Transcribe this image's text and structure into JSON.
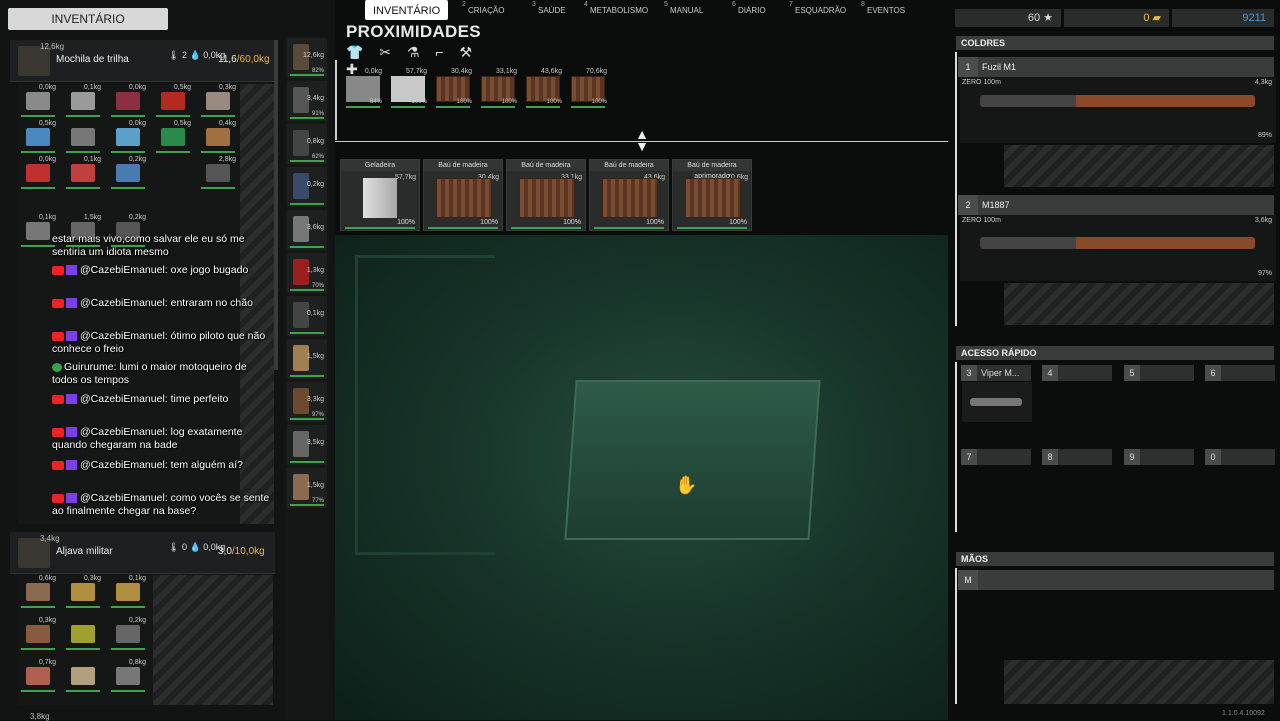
{
  "tabs": [
    {
      "num": "",
      "label": "INVENTÁRIO"
    },
    {
      "num": "2",
      "label": "CRIAÇÃO"
    },
    {
      "num": "3",
      "label": "SAÚDE"
    },
    {
      "num": "4",
      "label": "METABOLISMO"
    },
    {
      "num": "5",
      "label": "MANUAL"
    },
    {
      "num": "6",
      "label": "DIÁRIO"
    },
    {
      "num": "7",
      "label": "ESQUADRÃO"
    },
    {
      "num": "8",
      "label": "EVENTOS"
    }
  ],
  "left": {
    "title": "INVENTÁRIO",
    "pack1": {
      "weight": "12,6kg",
      "cond": "82%",
      "name": "Mochila de trilha",
      "temp_val": "2",
      "water_val": "0,0kg",
      "cap_used": "11,6",
      "cap_max": "/60,0kg"
    },
    "pack2": {
      "weight": "3,4kg",
      "cond": "91%",
      "name": "Aljava militar",
      "temp_val": "0",
      "water_val": "0,0kg",
      "cap_used": "3,0",
      "cap_max": "/10,0kg"
    },
    "pack3": {
      "weight": "3,8kg"
    },
    "grid1": [
      {
        "w": "0,0kg",
        "c": "#8a8a8a"
      },
      {
        "w": "0,1kg",
        "c": "#9a9a9a"
      },
      {
        "w": "0,0kg",
        "c": "#8a3040"
      },
      {
        "w": "0,5kg",
        "c": "#b32a20"
      },
      {
        "w": "0,3kg",
        "c": "#9a8a80"
      },
      {
        "w": "0,5kg",
        "c": "#4a88c0"
      },
      {
        "w": "",
        "c": "#777"
      },
      {
        "w": "0,0kg",
        "c": "#5aa0c8"
      },
      {
        "w": "0,5kg",
        "c": "#2a8a4a"
      },
      {
        "w": "0,4kg",
        "c": "#a07040"
      },
      {
        "w": "0,0kg",
        "c": "#c03030"
      },
      {
        "w": "0,1kg",
        "c": "#c04040"
      },
      {
        "w": "0,2kg",
        "c": "#4a7ab0"
      },
      {
        "w": "2,8kg",
        "c": "#555"
      },
      {
        "w": "0,1kg",
        "c": "#777"
      },
      {
        "w": "1,5kg",
        "c": "#666"
      },
      {
        "w": "0,2kg",
        "c": "#555"
      }
    ],
    "grid2": [
      {
        "w": "0,6kg",
        "c": "#8a6a50"
      },
      {
        "w": "0,3kg",
        "c": "#b09040"
      },
      {
        "w": "0,1kg",
        "c": "#b09040"
      },
      {
        "w": "0,3kg",
        "c": "#8a5a40"
      },
      {
        "w": "",
        "c": "#a0a030"
      },
      {
        "w": "0,2kg",
        "c": "#666"
      },
      {
        "w": "0,7kg",
        "c": "#b06050"
      },
      {
        "w": "",
        "c": "#b0a080"
      },
      {
        "w": "0,8kg",
        "c": "#777"
      }
    ],
    "col2": [
      {
        "w": "12,6kg",
        "p": "82%",
        "c": "#5a4a3a"
      },
      {
        "w": "3,4kg",
        "p": "91%",
        "c": "#555"
      },
      {
        "w": "0,8kg",
        "p": "62%",
        "c": "#444"
      },
      {
        "w": "0,2kg",
        "p": "",
        "c": "#3a4a6a"
      },
      {
        "w": "3,6kg",
        "p": "",
        "c": "#777"
      },
      {
        "w": "1,3kg",
        "p": "70%",
        "c": "#9a2020"
      },
      {
        "w": "0,1kg",
        "p": "",
        "c": "#444"
      },
      {
        "w": "1,5kg",
        "p": "",
        "c": "#a08050"
      },
      {
        "w": "3,3kg",
        "p": "97%",
        "c": "#6a4a30"
      },
      {
        "w": "3,5kg",
        "p": "",
        "c": "#666"
      },
      {
        "w": "1,5kg",
        "p": "77%",
        "c": "#8a6a50"
      }
    ],
    "chat": [
      {
        "u": "",
        "t": "estar mais vivo,como salvar ele eu só me sentiria um idiota mesmo",
        "src": ""
      },
      {
        "u": "@CazebiEmanuel:",
        "t": "oxe jogo bugado",
        "src": "yt"
      },
      {
        "u": "@CazebiEmanuel:",
        "t": "entraram no chão",
        "src": "yt"
      },
      {
        "u": "@CazebiEmanuel:",
        "t": "ótimo piloto que não conhece o freio",
        "src": "yt"
      },
      {
        "u": "Guirurume:",
        "t": "lumi o maior motoqueiro de todos os tempos",
        "src": "x"
      },
      {
        "u": "@CazebiEmanuel:",
        "t": "time perfeito",
        "src": "yt"
      },
      {
        "u": "@CazebiEmanuel:",
        "t": "log exatamente quando chegaram na bade",
        "src": "yt"
      },
      {
        "u": "@CazebiEmanuel:",
        "t": "tem alguém aí?",
        "src": "yt"
      },
      {
        "u": "@CazebiEmanuel:",
        "t": "como vocês se sente ao finalmente chegar na base?",
        "src": "yt"
      }
    ]
  },
  "proximity": {
    "title": "PROXIMIDADES",
    "icons": "👕 ✂ ⚗ ⌐ ⚒ ✚",
    "items": [
      {
        "w": "0,0kg",
        "p": "84%",
        "c": "#888"
      },
      {
        "w": "57,7kg",
        "p": "100%",
        "c": "#c8c8c8"
      },
      {
        "w": "30,4kg",
        "p": "100%",
        "c": "crate"
      },
      {
        "w": "33,1kg",
        "p": "100%",
        "c": "crate"
      },
      {
        "w": "43,6kg",
        "p": "100%",
        "c": "crate"
      },
      {
        "w": "70,6kg",
        "p": "100%",
        "c": "crate"
      }
    ],
    "boxes": [
      {
        "name": "Geladeira",
        "w": "57,7kg",
        "p": "100%",
        "t": "fridge"
      },
      {
        "name": "Baú de madeira",
        "w": "30,4kg",
        "p": "100%",
        "t": "crate"
      },
      {
        "name": "Baú de madeira",
        "w": "33,1kg",
        "p": "100%",
        "t": "crate"
      },
      {
        "name": "Baú de madeira",
        "w": "43,6kg",
        "p": "100%",
        "t": "crate"
      },
      {
        "name": "Baú de madeira aprimorado",
        "w": "70,6kg",
        "p": "100%",
        "t": "crate"
      }
    ]
  },
  "stats": {
    "stars": "60 ★",
    "gold": "0",
    "cash": "9211"
  },
  "right": {
    "holsters_title": "COLDRES",
    "weapons": [
      {
        "num": "1",
        "name": "Fuzil M1",
        "zero": "ZERO 100m",
        "w": "4,3kg",
        "p": "89%"
      },
      {
        "num": "2",
        "name": "M1887",
        "zero": "ZERO 100m",
        "w": "3,6kg",
        "p": "97%"
      }
    ],
    "quick_title": "ACESSO RÁPIDO",
    "quick": [
      {
        "num": "3",
        "name": "Viper M..."
      },
      {
        "num": "4",
        "name": ""
      },
      {
        "num": "5",
        "name": ""
      },
      {
        "num": "6",
        "name": ""
      },
      {
        "num": "7",
        "name": ""
      },
      {
        "num": "8",
        "name": ""
      },
      {
        "num": "9",
        "name": ""
      },
      {
        "num": "0",
        "name": ""
      }
    ],
    "hands_title": "MÃOS",
    "hands_slot": "M",
    "version": "1.1.0.4.10092"
  },
  "colors": {
    "accent": "#e8b83a",
    "cash": "#3b9be0",
    "bar": "#3fa34d",
    "night": "#17352a"
  }
}
